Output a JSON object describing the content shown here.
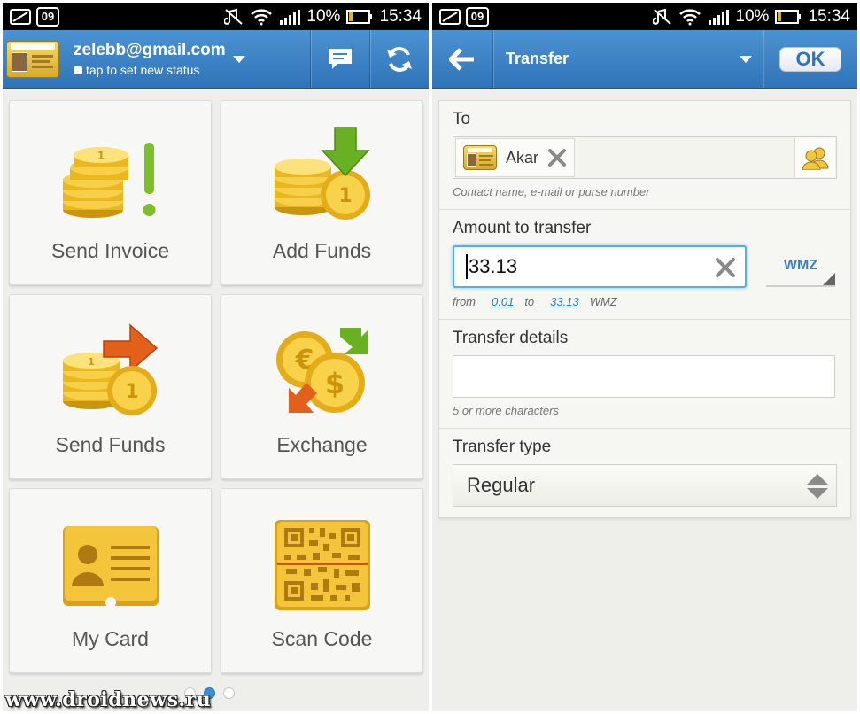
{
  "status_bar": {
    "battery": "10%",
    "time": "15:34",
    "calendar_day": "09"
  },
  "left": {
    "account": {
      "email": "zelebb@gmail.com",
      "status_hint": "tap to set new status",
      "card_brand": "webmoney"
    },
    "tiles": [
      {
        "label": "Send Invoice",
        "icon": "send-invoice-icon"
      },
      {
        "label": "Add Funds",
        "icon": "add-funds-icon"
      },
      {
        "label": "Send Funds",
        "icon": "send-funds-icon"
      },
      {
        "label": "Exchange",
        "icon": "exchange-icon"
      },
      {
        "label": "My Card",
        "icon": "my-card-icon"
      },
      {
        "label": "Scan Code",
        "icon": "scan-code-icon"
      }
    ],
    "pager": {
      "pages": 3,
      "active": 2
    },
    "watermark": "www.droidnews.ru"
  },
  "right": {
    "title": "Transfer",
    "ok_label": "OK",
    "to": {
      "label": "To",
      "recipient": "Akar",
      "hint": "Contact name, e-mail or purse number"
    },
    "amount": {
      "label": "Amount to transfer",
      "value": "33.13",
      "currency": "WMZ",
      "range_from_label": "from",
      "range_min": "0.01",
      "range_to_label": "to",
      "range_max": "33.13",
      "range_currency": "WMZ"
    },
    "details": {
      "label": "Transfer details",
      "value": "",
      "hint": "5 or more characters"
    },
    "type": {
      "label": "Transfer type",
      "selected": "Regular"
    }
  },
  "colors": {
    "accent_blue": "#3a84c8",
    "coin_gold": "#f0c020",
    "arrow_green": "#6ab023",
    "arrow_orange": "#e2601a"
  }
}
